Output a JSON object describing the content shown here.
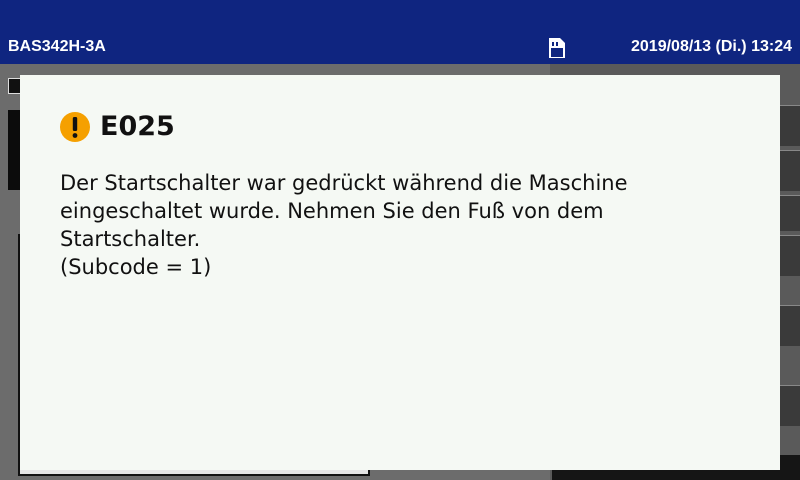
{
  "header": {
    "machine_model": "BAS342H-3A",
    "storage_icon": "sd-card-icon",
    "datetime": "2019/08/13 (Di.) 13:24",
    "background_color": "#0f2580"
  },
  "dialog": {
    "icon": "warning-icon",
    "icon_color": "#f5a000",
    "error_code": "E025",
    "message": "Der Startschalter war gedrückt während die Maschine\neingeschaltet wurde. Nehmen Sie den Fuß von dem\nStartschalter.\n(Subcode = 1)"
  }
}
